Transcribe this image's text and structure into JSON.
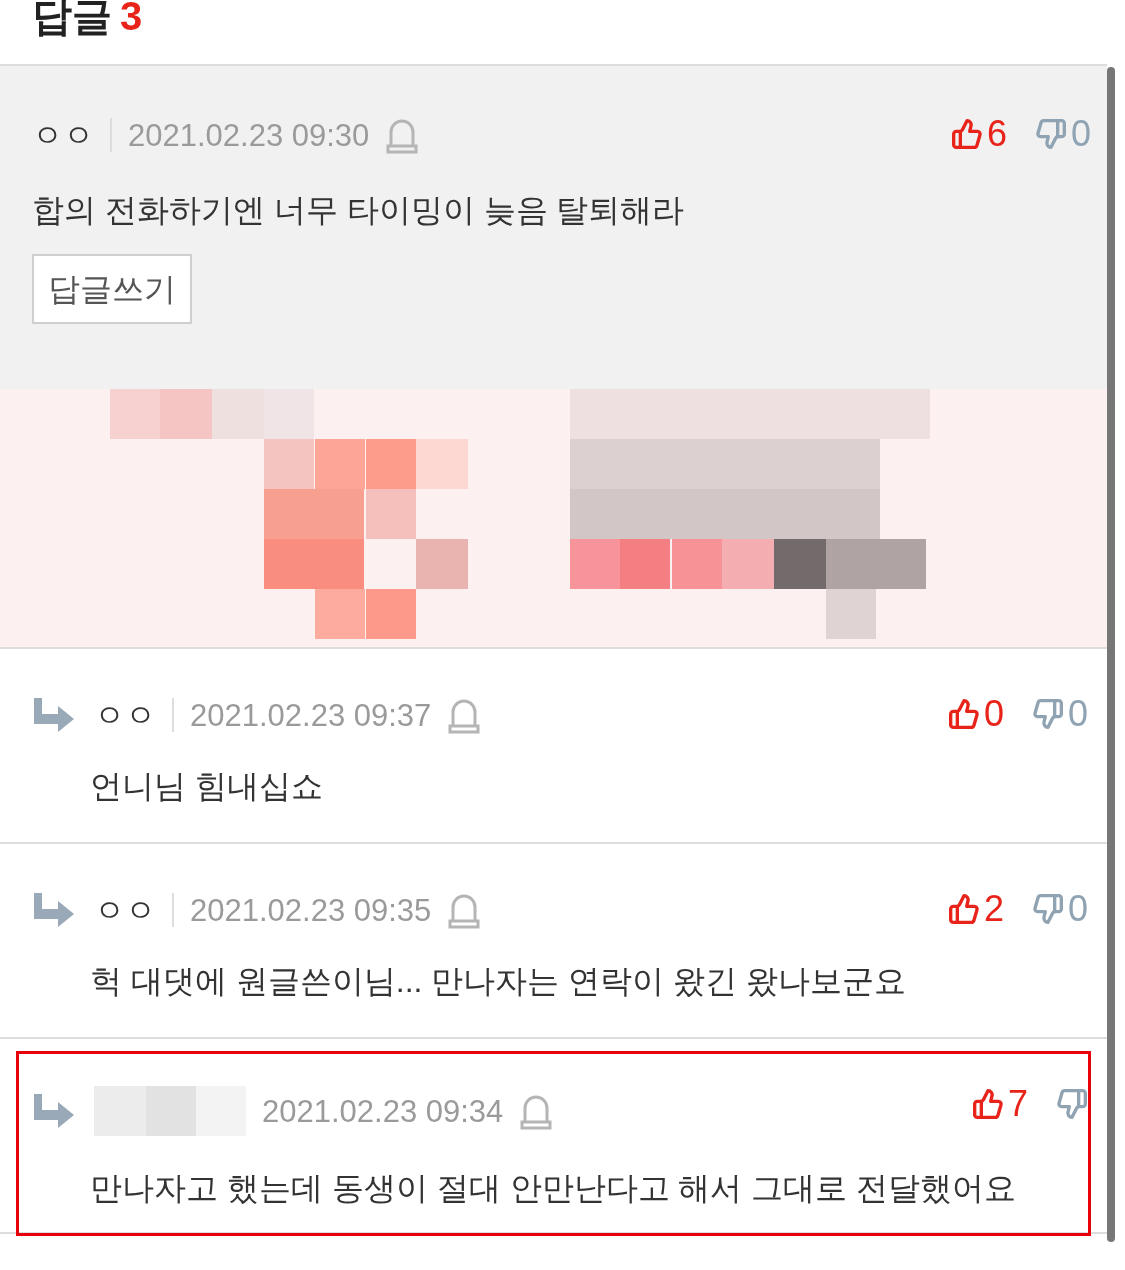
{
  "header": {
    "title": "답글",
    "count": "3"
  },
  "comment": {
    "author": "ㅇㅇ",
    "date": "2021.02.23 09:30",
    "likes": "6",
    "dislikes": "0",
    "text": "합의 전화하기엔 너무 타이밍이 늦음 탈퇴해라",
    "reply_button": "답글쓰기"
  },
  "replies": [
    {
      "author": "ㅇㅇ",
      "date": "2021.02.23 09:37",
      "likes": "0",
      "dislikes": "0",
      "text": "언니님 힘내십쇼",
      "highlighted": false
    },
    {
      "author": "ㅇㅇ",
      "date": "2021.02.23 09:35",
      "likes": "2",
      "dislikes": "0",
      "text": "헉 대댓에 원글쓴이님... 만나자는 연락이 왔긴 왔나보군요",
      "highlighted": false
    },
    {
      "author_redacted": true,
      "date": "2021.02.23 09:34",
      "likes": "7",
      "text": "만나자고 했는데 동생이 절대 안만난다고 해서 그대로 전달했어요",
      "highlighted": true
    }
  ]
}
